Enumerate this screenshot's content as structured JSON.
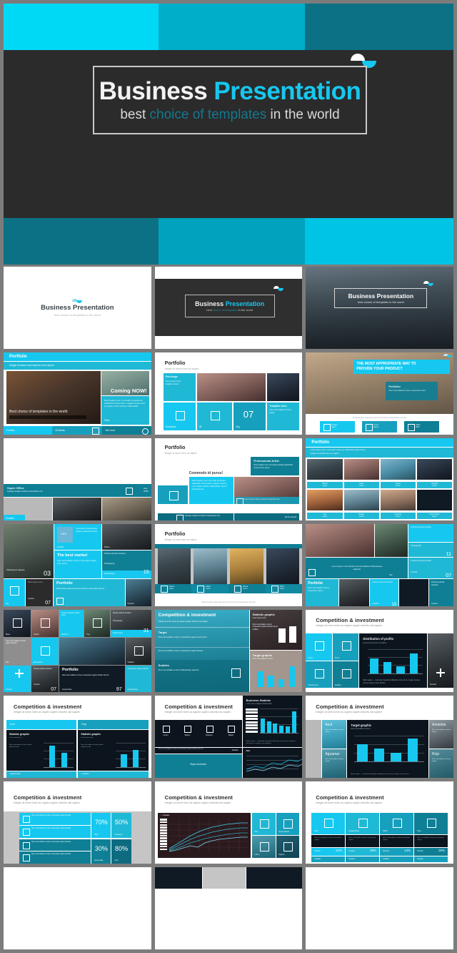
{
  "theme": {
    "cyan_bright": "#16c8ef",
    "cyan_mid": "#00aec9",
    "teal_dark": "#0d7186",
    "charcoal": "#2b2b2b",
    "page_bg": "#7c7c7c",
    "white": "#ffffff"
  },
  "hero": {
    "title_part1": "Business",
    "title_part2": "Presentation",
    "subtitle_part1": "best ",
    "subtitle_part2": "choice of templates",
    "subtitle_part3": " in the world",
    "top_band": [
      "#00d9f5",
      "#00aec9",
      "#0d7186"
    ],
    "bottom_band": [
      "#0d7186",
      "#00a2bd",
      "#00c4e4"
    ]
  },
  "slides": [
    {
      "id": "cover-light",
      "title_part1": "Business",
      "title_part2": "Presentation",
      "subtitle": "best choice of templates in the world",
      "style": "white-cover"
    },
    {
      "id": "cover-dark",
      "title_part1": "Business",
      "title_part2": "Presentation",
      "subtitle_part1": "best ",
      "subtitle_part2": "choice of templates",
      "subtitle_part3": " in the world",
      "style": "dark-cover"
    },
    {
      "id": "cover-photo",
      "title": "Business Presentation",
      "subtitle": "best choice of templates in the world",
      "style": "photo-cover"
    },
    {
      "id": "portfolio-coming-now",
      "header": "Portfolio",
      "subheader": "Integer tincidunt cras dapibus loren ipsum",
      "callout": "Coming NOW!",
      "body": "Morbi sapien nunc, commodo id gravida eu, sollicitudin cursus lorem. Integer sit amet nunc ac sapien cursus lobortis. Nulla facilisi.",
      "photo_caption": "Best choice of templates in the world",
      "footer_items": [
        "Portfolio",
        "All details",
        "See more"
      ],
      "link_label": "Other"
    },
    {
      "id": "portfolio-grid-07",
      "header": "Portfolio",
      "subheader": "Integer at lorem loren ac sapien",
      "tiles": [
        {
          "label": "Download",
          "icon": "square-icon"
        },
        {
          "label": "All",
          "icon": "square-icon"
        },
        {
          "label": "Day",
          "value": "07"
        },
        {
          "label": "Templates loren"
        }
      ],
      "side_block": "First image"
    },
    {
      "id": "product-way",
      "banner_line1": "THE MOST APPROPRIATE WAY TO",
      "banner_line2": "PROVIDE YOUR PRODUCT",
      "card_title": "Portfolio",
      "card_body": "Nunc sed sodales ut lorem consectetur lorem",
      "footer_note": "Pellentesque sapiente pulvinar tincidunt suspendisse nisi dui",
      "buttons": [
        {
          "label": "Design\nloren",
          "icon": "square-icon"
        },
        {
          "label": "Loren\nipsum",
          "icon": "square-icon"
        },
        {
          "label": "Office\n09%",
          "icon": "square-icon"
        }
      ]
    },
    {
      "id": "super-office",
      "caption_title": "Super Office",
      "caption_body": "Quisque sodales tincidunt suspendisse nisi",
      "badge_label": "Day\n2006",
      "tag": "Portfolio"
    },
    {
      "id": "professional-artist",
      "header": "Portfolio",
      "subheader": "Integer at lorem loren ac sapien",
      "card_title": "Professional Artist",
      "card_body": "Nunc sapien nunc commodo gravida sollicitudin cursus lorem ipsum",
      "quote_heading": "Commodo id purus!",
      "quote_body": "Morbi sapien nunc commodo id gravida sollicitudin cursus lorem. Integer sit amet nunc sapien lobortis. Nulla facilisi. Sed ut imperdiet erat.",
      "footer_left": "Quisque sodales tincidunt suspendisse nisi",
      "footer_right": "All the details",
      "image_note": "Lorem ipsum dolor sit amet consectetur nisi"
    },
    {
      "id": "portfolio-8-gallery",
      "header": "Portfolio",
      "subheader_line1": "Lorem ipsum nunc, commodo cursus ut, sollicitudin sapien lorem",
      "subheader_line2": "Integer at porttitor loren ac sapien",
      "captions": [
        "Nature\nLoren",
        "Style\nLoren",
        "Travel\nLoren",
        "Lifestyle\nLoren",
        "City\nLoren",
        "People\nLoren",
        "Concept\nLoren",
        "Composition\nLoren"
      ]
    },
    {
      "id": "best-market",
      "card_title": "The best market",
      "card_body": "Nunc sed sodales ut lorem consectetur sapien loren ipsum",
      "side_label": "100%",
      "side_body": "Consectetur Pellentesque sapiente pulvinar tincidunt",
      "photo_caption": "Pellentesque sapiente",
      "counter_left": "03",
      "counter_right": "15",
      "tiles": [
        {
          "label": "Pellentesque\nloren",
          "value": "07"
        },
        {
          "label": "Portfolio",
          "body": "Pellentesque sapiente pulvinar tincidunt suspendisse nisi dui"
        },
        {
          "label": "Pulvinar",
          "sub": "Photography"
        }
      ]
    },
    {
      "id": "portfolio-4-landscape",
      "header": "Portfolio",
      "subheader": "Integer at lorem loren ac sapien",
      "tiles": [
        {
          "label": "Nature\nLoren",
          "icon": "square-icon"
        },
        {
          "label": "Water\nLoren",
          "icon": "square-icon"
        },
        {
          "label": "Wheat\nLoren",
          "icon": "square-icon"
        },
        {
          "label": "Storm\nLoren",
          "icon": "square-icon"
        }
      ],
      "footer_note": "Pellentesque sapiente pulvinar tincidunt Suspendisse nisi dui"
    },
    {
      "id": "portfolio-mosaic",
      "caption": "Lorem ipsum nunc lobortis sit amet dapibus Pellentesque sapiente",
      "card_title": "Portfolio",
      "card_body": "Nunc sed sodales ut lorem consectetur sapien",
      "side_labels": [
        "Pulvinar pulvinar tincidunt",
        "Photography",
        "Pulvinar pulvinar tincidunt",
        "Lobortis"
      ],
      "counter_a": "11",
      "counter_b": "07"
    },
    {
      "id": "portfolio-tiles-31",
      "tiles": [
        {
          "label": "Blues"
        },
        {
          "label": "Gallery"
        },
        {
          "label": "Dolorum"
        },
        {
          "label": "Ting"
        },
        {
          "label": "Pellentesque",
          "value": "31"
        },
        {
          "label": "Nisi"
        },
        {
          "label": "Elementum"
        },
        {
          "label": "Sodales"
        },
        {
          "label": "Pulvinar",
          "value": "07"
        },
        {
          "label": "Portfolio",
          "value": "97"
        },
        {
          "label": "Suspendisse"
        }
      ],
      "add_label": "Pulvinar",
      "add_icon": "plus-icon"
    },
    {
      "id": "competition-target-graphic",
      "header": "Competition & investment",
      "subheader": "Integer at lorem loren ac sapien sapien lobortis nisi sapien",
      "section_target": "Target",
      "section_sodales": "Sodales",
      "section_body": "Nunc sed sodales ut lorem consectetur sapien lorem ipsum",
      "chart1_title": "Statistic graphic",
      "chart1_sub": "Loren ipsum loren",
      "chart2_title": "Target graphic",
      "chart2_sub": "Nunc sed sodales ut lorem",
      "chart_data": {
        "type": "bar",
        "title": "Statistic graphic",
        "categories": [
          "1",
          "2"
        ],
        "values": [
          62,
          72
        ],
        "ylim": [
          0,
          100
        ],
        "series_color": "#ffffff"
      }
    },
    {
      "id": "distribution-of-profits",
      "header": "Competition & investment",
      "subheader": "Integer at lorem loren ac sapien sapien lobortis nisi sapien",
      "tiles": [
        {
          "label": "Lorem"
        },
        {
          "label": "Purus"
        },
        {
          "label": "Pellentesque"
        },
        {
          "label": "Sodales"
        }
      ],
      "chart_title": "Distribution of profits",
      "chart_sub": "Lorem at lorem loren ac sapien",
      "chart_note": "Morbi sapien — commodo id gravida sollicitudin cursus lorem. Integer sit amet nunc ac sapien cursus lobortis.",
      "add_label": "Pulvinar",
      "add_icon": "plus-icon",
      "chart_data": {
        "type": "bar",
        "title": "Distribution of profits",
        "categories": [
          "1",
          "2",
          "3",
          "4"
        ],
        "values": [
          62,
          46,
          30,
          82
        ],
        "ylim": [
          0,
          100
        ],
        "series_color": "#16c8ef"
      }
    },
    {
      "id": "two-statistic-graphics",
      "header": "Competition & investment",
      "subheader": "Integer at lorem loren ac sapien sapien lobortis nisi sapien",
      "col1_label": "Azul",
      "col2_label": "Rojo",
      "chart1_title": "Statistic graphic",
      "chart1_sub": "Loren ipsum loren",
      "chart2_title": "Statistic graphic",
      "chart2_sub": "Loren ipsum loren",
      "foot1": "Apasionados",
      "foot2": "Amables",
      "chart_data": [
        {
          "type": "bar",
          "title": "Statistic graphic",
          "categories": [
            "1",
            "2"
          ],
          "values": [
            88,
            60
          ],
          "ylim": [
            0,
            100
          ],
          "series_color": "#16c8ef"
        },
        {
          "type": "bar",
          "title": "Statistic graphic",
          "categories": [
            "1",
            "2"
          ],
          "values": [
            52,
            72
          ],
          "ylim": [
            0,
            100
          ],
          "series_color": "#16c8ef"
        }
      ]
    },
    {
      "id": "business-statistic",
      "header": "Competition & investment",
      "subheader": "Integer at lorem loren ac sapien sapien lobortis nisi sapien",
      "tiles": [
        {
          "label": "Lorem"
        },
        {
          "label": "Sapien"
        },
        {
          "label": "Dolorum"
        },
        {
          "label": "Magni"
        }
      ],
      "note": "Nunc sed sodales ut lorem consectetur sapien lobortis nisi dui",
      "note_link": "Sodales",
      "map_label": "Maps business",
      "panel_title": "Business Statistic",
      "panel_sub": "Lorem nunc at sapien lobortis dolor",
      "panel_note": "Morbi sapien — commodo id gravida sollicitudin cursus lorem. Integer sit amet nunc ac sapien cursus lobortis.",
      "sub_panel_title": "Nisi",
      "chart_data": {
        "type": "bar",
        "title": "Business Statistic",
        "categories": [
          "1",
          "2",
          "3",
          "4",
          "5",
          "6"
        ],
        "values": [
          58,
          46,
          38,
          30,
          26,
          88
        ],
        "ylim": [
          0,
          100
        ],
        "series_color": "#16c8ef"
      }
    },
    {
      "id": "target-graphic-azul",
      "header": "Competition & investment",
      "subheader": "Integer at lorem loren ac sapien sapien lobortis nisi sapien",
      "left_labels": [
        "Azul",
        "Aguamar"
      ],
      "right_labels": [
        "Amatista",
        "Rojo"
      ],
      "chart_title": "Target graphic",
      "chart_sub": "Nunc sed sodales ut lorem",
      "chart_note": "Morbi sapien — commodo id gravida sollicitudin cursus lorem. Integer sit amet nunc.",
      "chart_data": {
        "type": "bar",
        "title": "Target graphic",
        "categories": [
          "1",
          "2",
          "3",
          "4"
        ],
        "values": [
          66,
          50,
          34,
          88
        ],
        "ylim": [
          0,
          100
        ],
        "series_color": "#16c8ef"
      }
    },
    {
      "id": "percent-grid",
      "header": "Competition & investment",
      "subheader": "Integer at lorem loren ac sapien sapien lobortis nisi sapien",
      "rows": [
        {
          "text": "Nunc sed sodales ut lorem consectetur sapien lobortis",
          "icon": "square-icon"
        },
        {
          "text": "Nunc sed sodales ut lorem consectetur sapien lobortis",
          "icon": "square-icon"
        },
        {
          "text": "Nunc sed sodales ut lorem consectetur sapien lobortis",
          "icon": "square-icon"
        },
        {
          "text": "Nunc sed sodales ut lorem consectetur sapien lobortis",
          "icon": "square-icon"
        }
      ],
      "chart_data": {
        "type": "bar",
        "title": "Competition & investment percentages",
        "categories": [
          "Rojo",
          "Turquesa",
          "Esmeralda",
          "Azul"
        ],
        "values": [
          70,
          50,
          30,
          80
        ],
        "labels": [
          "70%",
          "50%",
          "30%",
          "80%"
        ],
        "ylim": [
          0,
          100
        ]
      }
    },
    {
      "id": "line-chart-slide",
      "header": "Competition & investment",
      "subheader": "Integer at lorem loren ac sapien sapien lobortis nisi sapien",
      "legend_title": "Sodales",
      "tiles": [
        {
          "label": "Nisi"
        },
        {
          "label": "Suspendisse"
        },
        {
          "label": "Loren"
        },
        {
          "label": "Sapien"
        }
      ],
      "chart_data": {
        "type": "line",
        "title": "Sodales",
        "x": [
          1,
          2,
          3,
          4,
          5,
          6,
          7,
          8,
          9,
          10,
          11,
          12,
          13,
          14,
          15,
          16,
          17,
          18
        ],
        "series": [
          {
            "name": "Serie 1",
            "values": [
              12,
              22,
              34,
              44,
              52,
              58,
              64,
              70,
              74,
              78,
              80,
              82,
              84,
              85,
              86,
              87,
              88,
              88
            ]
          },
          {
            "name": "Serie 2",
            "values": [
              8,
              16,
              26,
              36,
              44,
              50,
              54,
              58,
              62,
              65,
              68,
              70,
              71,
              72,
              73,
              74,
              74,
              75
            ]
          },
          {
            "name": "Serie 3",
            "values": [
              5,
              10,
              18,
              26,
              32,
              38,
              42,
              46,
              50,
              53,
              56,
              58,
              60,
              61,
              62,
              63,
              64,
              64
            ]
          },
          {
            "name": "Serie 4",
            "values": [
              3,
              6,
              10,
              16,
              20,
              14,
              22,
              30,
              36,
              40,
              44,
              46,
              48,
              50,
              51,
              52,
              53,
              54
            ]
          }
        ],
        "ylim": [
          0,
          100
        ],
        "grid": true
      }
    },
    {
      "id": "four-column-compare",
      "header": "Competition & investment",
      "subheader": "Integer at lorem loren ac sapien sapien lobortis nisi sapien",
      "columns": [
        {
          "label": "Rojo",
          "body": "Nunc sed sodales ut lorem consectetur sapien",
          "value": "Pulvinar",
          "num": "52%",
          "foot": "Sodales",
          "icon": "square-icon"
        },
        {
          "label": "Suspendisse",
          "body": "Nunc sed sodales ut lorem consectetur sapien",
          "value": "Pulvinar",
          "num": "08%",
          "foot": "Sodales",
          "icon": "square-icon"
        },
        {
          "label": "Morbi",
          "body": "Nunc sed sodales ut lorem consectetur sapien",
          "value": "Pulvinar",
          "num": "14%",
          "foot": "Sodales",
          "icon": "square-icon"
        },
        {
          "label": "Rojo",
          "body": "Nunc sed sodales ut lorem consectetur sapien",
          "value": "Pulvinar",
          "num": "28%",
          "foot": "Sodales",
          "icon": "square-icon"
        }
      ]
    }
  ]
}
